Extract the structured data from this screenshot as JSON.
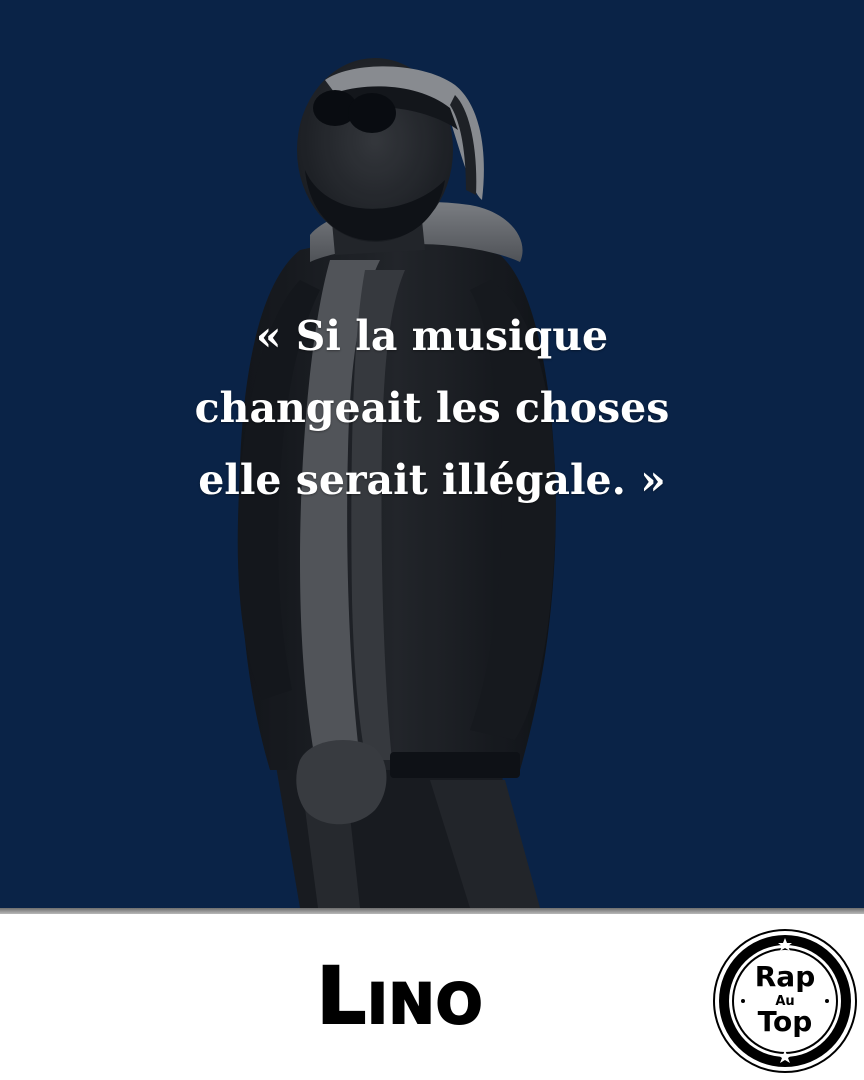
{
  "quote": {
    "lines": [
      "« Si la musique",
      "changeait les choses",
      "elle serait illégale. »"
    ]
  },
  "artist": {
    "name": "Lino"
  },
  "logo": {
    "word_top": "Rap",
    "word_middle": "Au",
    "word_bottom": "Top"
  },
  "colors": {
    "background_navy": "#0b2447",
    "quote_text": "#ffffff",
    "bottom_panel": "#ffffff",
    "artist_text": "#000000"
  }
}
